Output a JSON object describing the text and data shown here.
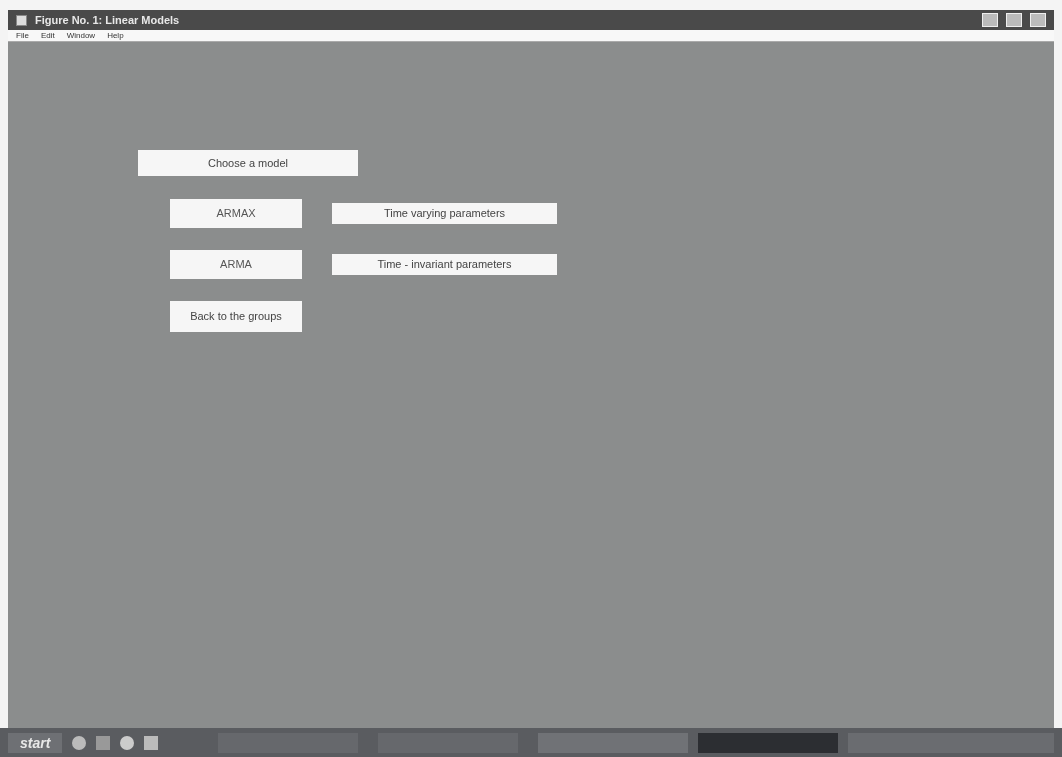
{
  "window": {
    "title": "Figure No. 1: Linear Models"
  },
  "menu": [
    "File",
    "Edit",
    "Window",
    "Help"
  ],
  "heading": "Choose a model",
  "models": [
    {
      "button": "ARMAX",
      "description": "Time varying parameters"
    },
    {
      "button": "ARMA",
      "description": "Time - invariant parameters"
    }
  ],
  "back_button": "Back to the groups",
  "taskbar": {
    "start": "start"
  }
}
